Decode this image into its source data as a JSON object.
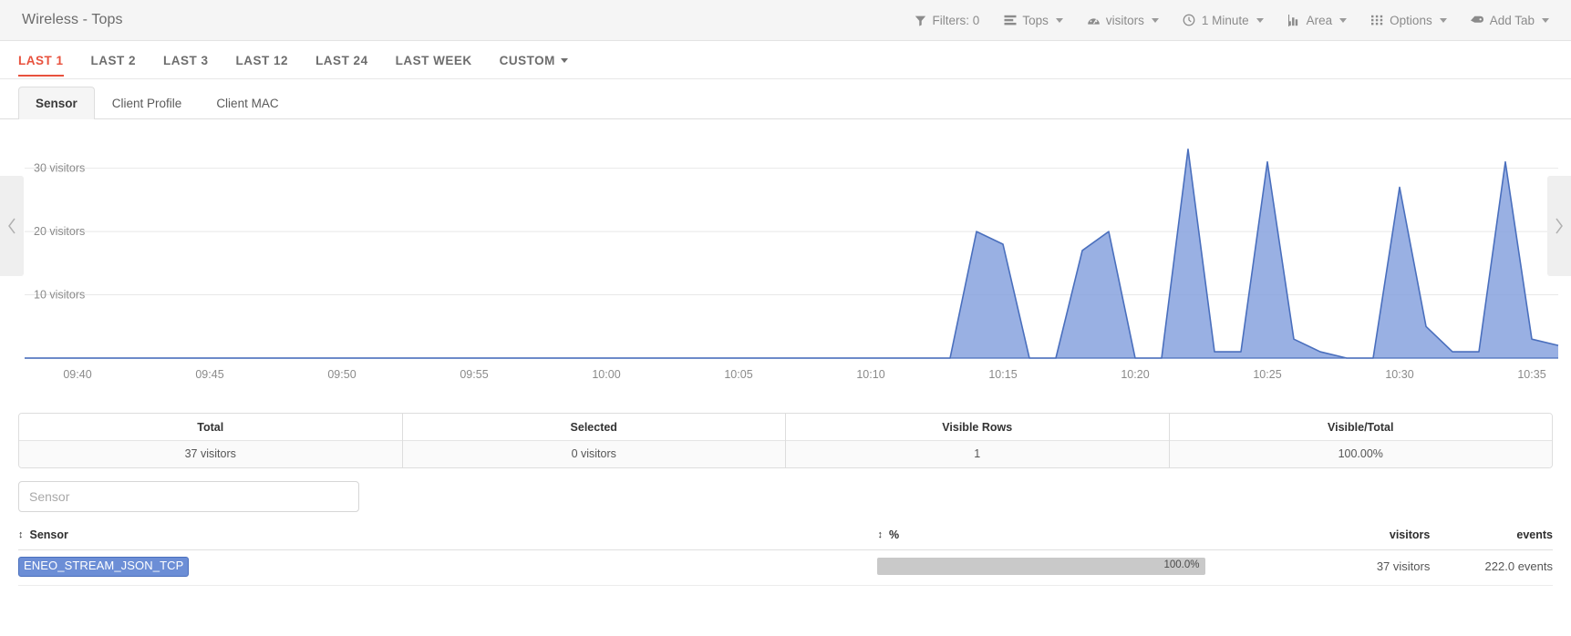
{
  "header": {
    "title": "Wireless - Tops",
    "toolbar": [
      {
        "label": "Filters: 0",
        "icon": "filter-icon",
        "caret": false,
        "name": "filters"
      },
      {
        "label": "Tops",
        "icon": "list-icon",
        "caret": true,
        "name": "tops"
      },
      {
        "label": "visitors",
        "icon": "gauge-icon",
        "caret": true,
        "name": "visitors"
      },
      {
        "label": "1 Minute",
        "icon": "clock-icon",
        "caret": true,
        "name": "interval"
      },
      {
        "label": "Area",
        "icon": "bar-chart-icon",
        "caret": true,
        "name": "charttype"
      },
      {
        "label": "Options",
        "icon": "grid-icon",
        "caret": true,
        "name": "options"
      },
      {
        "label": "Add Tab",
        "icon": "tag-icon",
        "caret": true,
        "name": "addtab"
      }
    ]
  },
  "range_tabs": [
    {
      "label": "LAST 1",
      "active": true,
      "caret": false
    },
    {
      "label": "LAST 2",
      "active": false,
      "caret": false
    },
    {
      "label": "LAST 3",
      "active": false,
      "caret": false
    },
    {
      "label": "LAST 12",
      "active": false,
      "caret": false
    },
    {
      "label": "LAST 24",
      "active": false,
      "caret": false
    },
    {
      "label": "LAST WEEK",
      "active": false,
      "caret": false
    },
    {
      "label": "CUSTOM",
      "active": false,
      "caret": true
    }
  ],
  "sub_tabs": [
    {
      "label": "Sensor",
      "active": true
    },
    {
      "label": "Client Profile",
      "active": false
    },
    {
      "label": "Client MAC",
      "active": false
    }
  ],
  "chart_nav": {
    "prev": "‹",
    "next": "›"
  },
  "chart_data": {
    "type": "area",
    "title": "",
    "xlabel": "",
    "ylabel": "visitors",
    "ylim": [
      0,
      36
    ],
    "grid": true,
    "legend_position": "none",
    "series_color": "#829fdd",
    "line_color": "#4a6fbd",
    "ytick_labels": [
      "30 visitors",
      "20 visitors",
      "10 visitors"
    ],
    "yticks": [
      30,
      20,
      10
    ],
    "xtick_labels": [
      "09:40",
      "09:45",
      "09:50",
      "09:55",
      "10:00",
      "10:05",
      "10:10",
      "10:15",
      "10:20",
      "10:25",
      "10:30",
      "10:35"
    ],
    "x": [
      "09:38",
      "09:39",
      "09:40",
      "09:41",
      "09:42",
      "09:43",
      "09:44",
      "09:45",
      "09:46",
      "09:47",
      "09:48",
      "09:49",
      "09:50",
      "09:51",
      "09:52",
      "09:53",
      "09:54",
      "09:55",
      "09:56",
      "09:57",
      "09:58",
      "09:59",
      "10:00",
      "10:01",
      "10:02",
      "10:03",
      "10:04",
      "10:05",
      "10:06",
      "10:07",
      "10:08",
      "10:09",
      "10:10",
      "10:11",
      "10:12",
      "10:13",
      "10:14",
      "10:15",
      "10:16",
      "10:17",
      "10:18",
      "10:19",
      "10:20",
      "10:21",
      "10:22",
      "10:23",
      "10:24",
      "10:25",
      "10:26",
      "10:27",
      "10:28",
      "10:29",
      "10:30",
      "10:31",
      "10:32",
      "10:33",
      "10:34",
      "10:35",
      "10:36"
    ],
    "series": [
      {
        "name": "visitors",
        "values": [
          0,
          0,
          0,
          0,
          0,
          0,
          0,
          0,
          0,
          0,
          0,
          0,
          0,
          0,
          0,
          0,
          0,
          0,
          0,
          0,
          0,
          0,
          0,
          0,
          0,
          0,
          0,
          0,
          0,
          0,
          0,
          0,
          0,
          0,
          0,
          0,
          20,
          18,
          0,
          0,
          17,
          20,
          0,
          0,
          33,
          1,
          1,
          31,
          3,
          1,
          0,
          0,
          27,
          5,
          1,
          1,
          31,
          3,
          2
        ]
      }
    ]
  },
  "summary": {
    "columns": [
      {
        "head": "Total",
        "value": "37 visitors"
      },
      {
        "head": "Selected",
        "value": "0 visitors"
      },
      {
        "head": "Visible Rows",
        "value": "1"
      },
      {
        "head": "Visible/Total",
        "value": "100.00%"
      }
    ]
  },
  "search": {
    "placeholder": "Sensor",
    "value": ""
  },
  "table": {
    "headers": {
      "sensor": "Sensor",
      "percent": "%",
      "visitors": "visitors",
      "events": "events"
    },
    "sort_icon": "↕",
    "rows": [
      {
        "sensor": "ENEO_STREAM_JSON_TCP",
        "percent_label": "100.0%",
        "percent_value": 100,
        "visitors": "37 visitors",
        "events": "222.0 events"
      }
    ]
  },
  "colors": {
    "accent": "#e8513d",
    "chart_fill": "#829fdd",
    "chart_stroke": "#4a6fbd",
    "tag_bg": "#6c8ed6",
    "header_bg": "#f5f5f5"
  }
}
